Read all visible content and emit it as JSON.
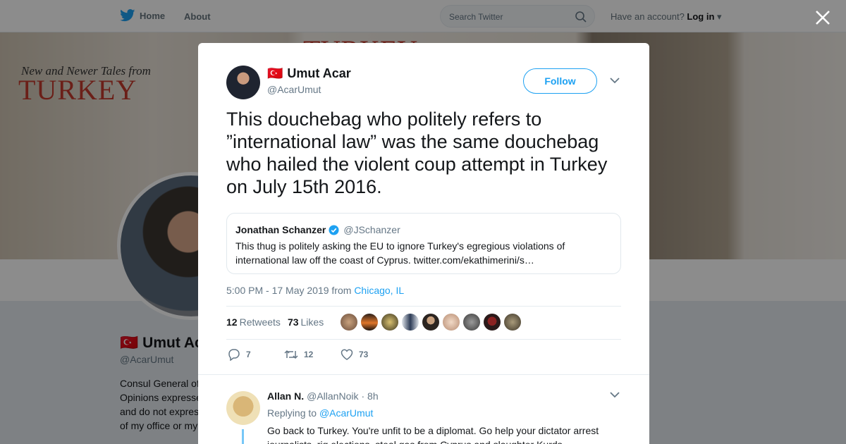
{
  "nav": {
    "home_label": "Home",
    "about_label": "About",
    "search_placeholder": "Search Twitter",
    "account_prompt": "Have an account?",
    "login_label": "Log in"
  },
  "background_profile": {
    "banner_line1": "New and Newer Tales from",
    "banner_line2": "TURKEY",
    "banner_line3": "TURKEY",
    "name": "Umut Ac",
    "handle": "@AcarUmut",
    "bio_lines": [
      "Consul General of",
      "Opinions expresse",
      "and do not expres",
      "of my office or my"
    ]
  },
  "tweet": {
    "flag": "🇹🇷",
    "author_name": "Umut Acar",
    "author_handle": "@AcarUmut",
    "follow_label": "Follow",
    "text": "This douchebag who politely refers to ”international law” was the same douchebag who hailed the violent coup attempt in Turkey on July 15th 2016.",
    "quoted": {
      "name": "Jonathan Schanzer",
      "handle": "@JSchanzer",
      "text": "This thug is politely asking the EU to ignore Turkey's egregious violations of international law off the coast of Cyprus. twitter.com/ekathimerini/s…"
    },
    "timestamp": "5:00 PM - 17 May 2019 from",
    "location": "Chicago, IL",
    "retweets_count": "12",
    "retweets_label": "Retweets",
    "likes_count": "73",
    "likes_label": "Likes",
    "actions": {
      "replies": "7",
      "retweets": "12",
      "likes": "73"
    }
  },
  "reply": {
    "name": "Allan N.",
    "handle": "@AllanNoik",
    "time": "· 8h",
    "replying_to_label": "Replying to",
    "replying_to_handle": "@AcarUmut",
    "text": "Go back to Turkey. You're unfit to be a diplomat.  Go help your dictator arrest journalists, rig elections, steal gas from Cyprus and slaughter Kurds."
  },
  "colors": {
    "accent": "#1da1f2",
    "text": "#14171a",
    "muted": "#657786"
  },
  "icons": [
    "twitter-bird-icon",
    "search-icon",
    "close-icon",
    "chevron-down-icon",
    "verified-badge-icon",
    "reply-icon",
    "retweet-icon",
    "like-icon"
  ]
}
